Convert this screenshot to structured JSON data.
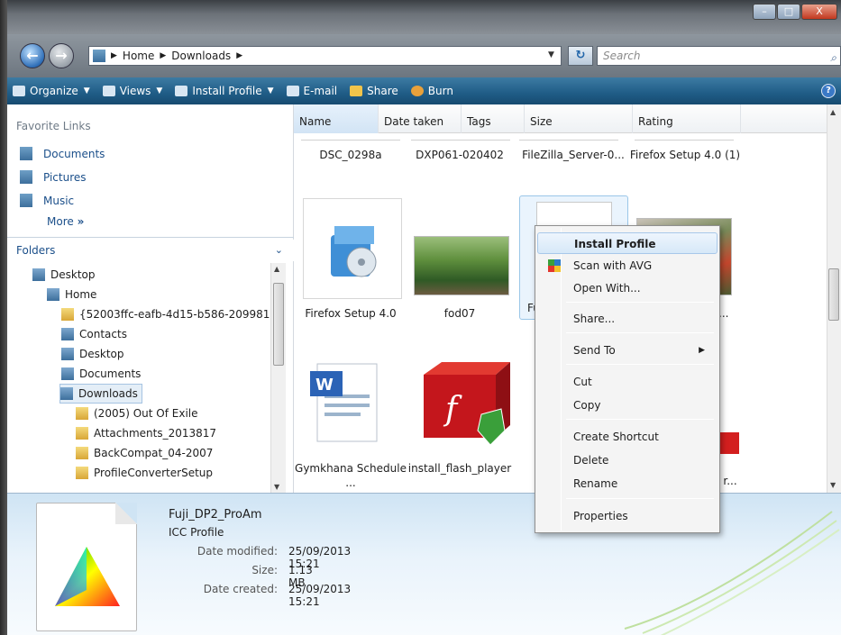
{
  "window": {
    "controls": [
      "–",
      "□",
      "X"
    ]
  },
  "address": {
    "path": [
      "Home",
      "Downloads"
    ],
    "search_placeholder": "Search"
  },
  "toolbar": {
    "items": [
      "Organize",
      "Views",
      "Install Profile",
      "E-mail",
      "Share",
      "Burn"
    ],
    "help": "?"
  },
  "nav": {
    "favorites_header": "Favorite Links",
    "favorites": [
      "Documents",
      "Pictures",
      "Music"
    ],
    "more": "More",
    "folders_header": "Folders",
    "tree": [
      "Desktop",
      "Home",
      "{52003ffc-eafb-4d15-b586-209981",
      "Contacts",
      "Desktop",
      "Documents",
      "Downloads",
      "(2005) Out Of Exile",
      "Attachments_2013817",
      "BackCompat_04-2007",
      "ProfileConverterSetup"
    ]
  },
  "columns": [
    "Name",
    "Date taken",
    "Tags",
    "Size",
    "Rating"
  ],
  "files": {
    "row1": [
      "DSC_0298a",
      "DXP061-020402",
      "FileZilla_Server-0...",
      "Firefox Setup 4.0 (1)"
    ],
    "row2": [
      "Firefox Setup 4.0",
      "fod07",
      "Fu",
      "fi..."
    ],
    "row3": [
      "Gymkhana Schedule ...",
      "install_flash_player",
      "r..."
    ]
  },
  "context_menu": {
    "items": [
      "Install Profile",
      "Scan with AVG",
      "Open With...",
      "Share...",
      "Send To",
      "Cut",
      "Copy",
      "Create Shortcut",
      "Delete",
      "Rename",
      "Properties"
    ]
  },
  "preview": {
    "name": "Fuji_DP2_ProAm",
    "type": "ICC Profile",
    "rows": [
      {
        "label": "Date modified:",
        "value": "25/09/2013 15:21"
      },
      {
        "label": "Size:",
        "value": "1.13 MB"
      },
      {
        "label": "Date created:",
        "value": "25/09/2013 15:21"
      }
    ]
  },
  "colors": {
    "toolbar": "#1f5c86",
    "selection": "#eaf4fd"
  }
}
